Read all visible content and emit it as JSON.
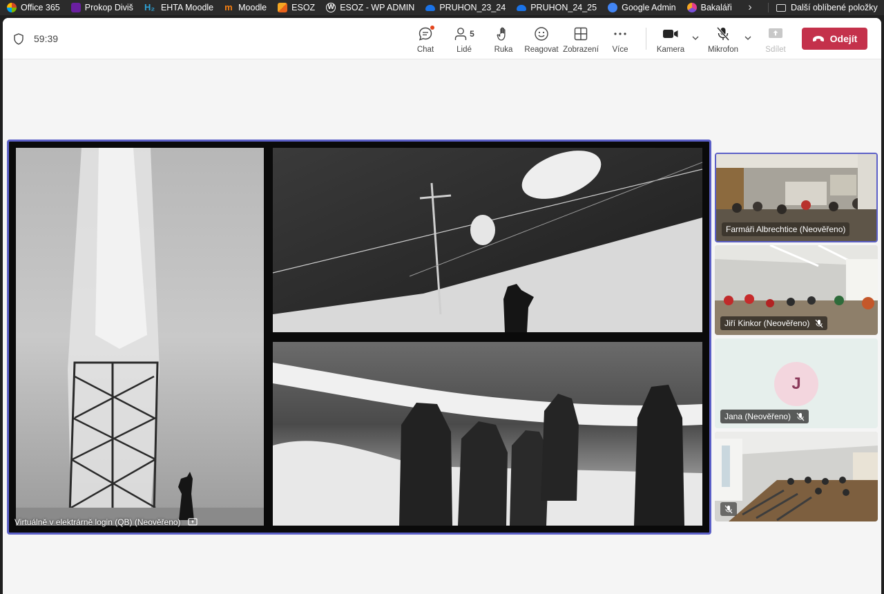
{
  "bookmarks": {
    "items": [
      {
        "label": "Office 365",
        "icon": "office-icon",
        "color": "#d24726"
      },
      {
        "label": "Prokop Diviš",
        "icon": "site-icon",
        "color": "#7a2fb0"
      },
      {
        "label": "EHTA Moodle",
        "icon": "h2-icon",
        "color": "#2fa4d8"
      },
      {
        "label": "Moodle",
        "icon": "moodle-icon",
        "color": "#f98012"
      },
      {
        "label": "ESOZ",
        "icon": "esoz-icon",
        "color": "#e8611a"
      },
      {
        "label": "ESOZ - WP ADMIN",
        "icon": "wordpress-icon",
        "color": "#ffffff"
      },
      {
        "label": "PRUHON_23_24",
        "icon": "onedrive-icon",
        "color": "#1a73e8"
      },
      {
        "label": "PRUHON_24_25",
        "icon": "onedrive-icon",
        "color": "#1a73e8"
      },
      {
        "label": "Google Admin",
        "icon": "google-admin-icon",
        "color": "#4285f4"
      },
      {
        "label": "Bakaláři",
        "icon": "bakalari-icon",
        "color": "#e23c8c"
      }
    ],
    "other_label": "Další oblíbené položky"
  },
  "call": {
    "timer": "59:39",
    "toolbar": {
      "chat_label": "Chat",
      "people_label": "Lidé",
      "people_count": "5",
      "raise_label": "Ruka",
      "react_label": "Reagovat",
      "view_label": "Zobrazení",
      "more_label": "Více",
      "camera_label": "Kamera",
      "mic_label": "Mikrofon",
      "share_label": "Sdílet",
      "leave_label": "Odejít"
    }
  },
  "stage": {
    "presenter_name": "Virtuálně v elektrárně login (QB) (Neověřeno)"
  },
  "participants": [
    {
      "name": "Farmáři Albrechtice (Neověřeno)",
      "muted": false
    },
    {
      "name": "Jiří Kinkor (Neověřeno)",
      "muted": true
    },
    {
      "name": "Jana (Neověřeno)",
      "muted": true,
      "initial": "J"
    },
    {
      "name": "",
      "muted": true
    }
  ],
  "colors": {
    "accent": "#5b5fc7",
    "leave": "#c4314b"
  }
}
